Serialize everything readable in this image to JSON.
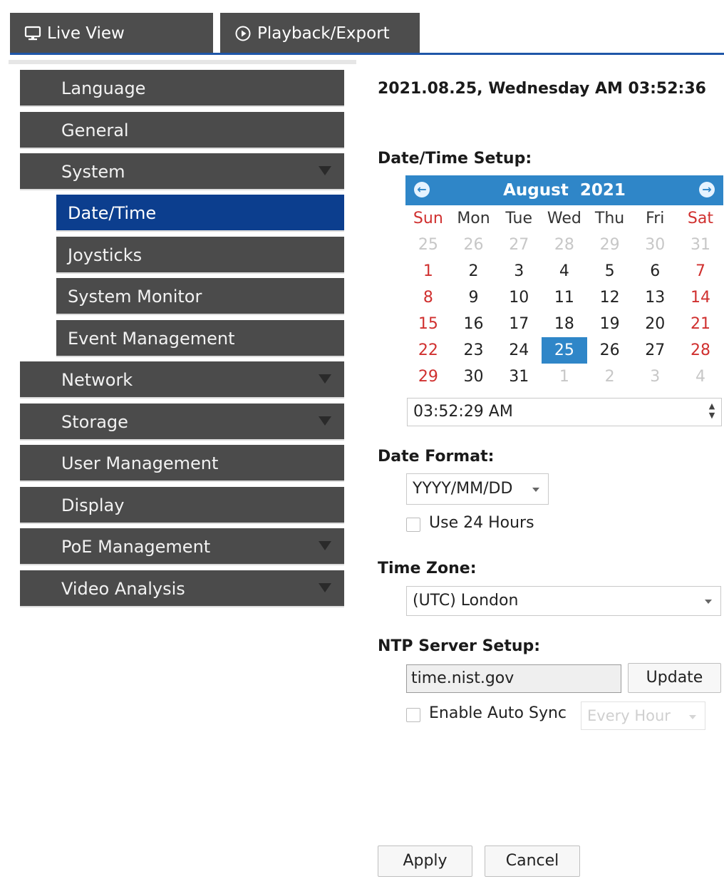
{
  "tabs": {
    "live_view": "Live View",
    "playback_export": "Playback/Export"
  },
  "sidebar": {
    "items": [
      {
        "label": "Language",
        "has_arrow": false
      },
      {
        "label": "General",
        "has_arrow": false
      },
      {
        "label": "System",
        "has_arrow": true
      },
      {
        "label": "Date/Time",
        "sub": true,
        "active": true
      },
      {
        "label": "Joysticks",
        "sub": true
      },
      {
        "label": "System Monitor",
        "sub": true
      },
      {
        "label": "Event Management",
        "sub": true
      },
      {
        "label": "Network",
        "has_arrow": true
      },
      {
        "label": "Storage",
        "has_arrow": true
      },
      {
        "label": "User Management",
        "has_arrow": false
      },
      {
        "label": "Display",
        "has_arrow": false
      },
      {
        "label": "PoE Management",
        "has_arrow": true
      },
      {
        "label": "Video Analysis",
        "has_arrow": true
      }
    ]
  },
  "main": {
    "current_datetime": "2021.08.25, Wednesday AM 03:52:36",
    "datetime_setup_label": "Date/Time Setup:",
    "calendar": {
      "month": "August",
      "year": "2021",
      "weekdays": [
        "Sun",
        "Mon",
        "Tue",
        "Wed",
        "Thu",
        "Fri",
        "Sat"
      ],
      "weeks": [
        [
          "25",
          "26",
          "27",
          "28",
          "29",
          "30",
          "31"
        ],
        [
          "1",
          "2",
          "3",
          "4",
          "5",
          "6",
          "7"
        ],
        [
          "8",
          "9",
          "10",
          "11",
          "12",
          "13",
          "14"
        ],
        [
          "15",
          "16",
          "17",
          "18",
          "19",
          "20",
          "21"
        ],
        [
          "22",
          "23",
          "24",
          "25",
          "26",
          "27",
          "28"
        ],
        [
          "29",
          "30",
          "31",
          "1",
          "2",
          "3",
          "4"
        ]
      ],
      "selected_day": "25"
    },
    "time_value": "03:52:29 AM",
    "date_format_label": "Date Format:",
    "date_format_value": "YYYY/MM/DD",
    "use_24_hours_label": "Use 24 Hours",
    "time_zone_label": "Time Zone:",
    "time_zone_value": "(UTC) London",
    "ntp_label": "NTP Server Setup:",
    "ntp_server_value": "time.nist.gov",
    "update_label": "Update",
    "enable_auto_sync_label": "Enable Auto Sync",
    "auto_sync_interval": "Every Hour",
    "apply_label": "Apply",
    "cancel_label": "Cancel"
  },
  "colors": {
    "menu_bg": "#4b4b4b",
    "menu_active": "#0c3e8e",
    "calendar_header": "#2f86c8",
    "weekend_red": "#d0302f"
  }
}
